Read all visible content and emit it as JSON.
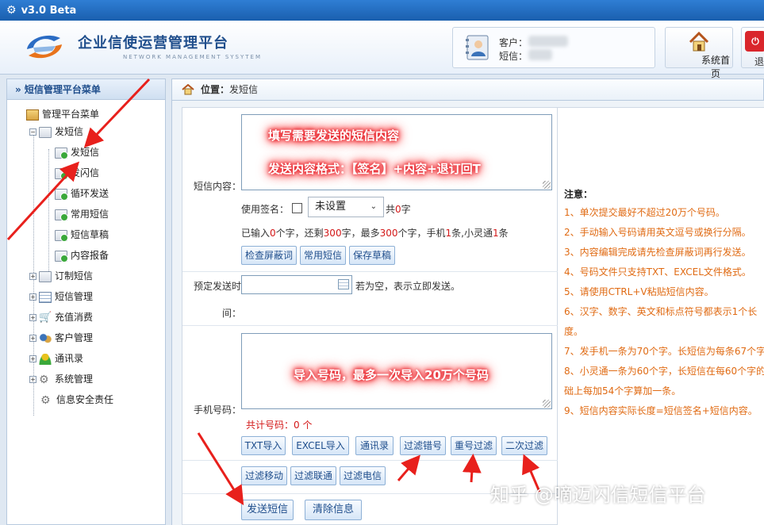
{
  "window": {
    "title": "v3.0 Beta"
  },
  "header": {
    "brand": "企业信使运营管理平台",
    "brand_sub": "NETWORK  MANAGEMENT SYSYTEM",
    "customer_label": "客户：",
    "sms_label": "短信：",
    "home_label": "系统首页",
    "exit_label": "退"
  },
  "sidebar": {
    "title": "» 短信管理平台菜单",
    "root": "管理平台菜单",
    "items": [
      {
        "label": "发短信"
      },
      {
        "label": "发短信"
      },
      {
        "label": "发闪信"
      },
      {
        "label": "循环发送"
      },
      {
        "label": "常用短信"
      },
      {
        "label": "短信草稿"
      },
      {
        "label": "内容报备"
      },
      {
        "label": "订制短信"
      },
      {
        "label": "短信管理"
      },
      {
        "label": "充值消费"
      },
      {
        "label": "客户管理"
      },
      {
        "label": "通讯录"
      },
      {
        "label": "系统管理"
      },
      {
        "label": "信息安全责任"
      }
    ]
  },
  "breadcrumb": {
    "prefix": "位置：",
    "current": "发短信"
  },
  "form": {
    "content_label": "短信内容：",
    "annotation_1": "填写需要发送的短信内容",
    "annotation_2": "发送内容格式：【签名】+内容+退订回T",
    "signature_label": "使用签名：",
    "signature_value": "未设置",
    "signature_count_prefix": "共",
    "signature_count": "0",
    "signature_count_suffix": "字",
    "count_text": {
      "p1": "已输入",
      "input_count": "0",
      "p2": "个字，还剩",
      "remaining": "300",
      "p3": "字，最多",
      "max": "300",
      "p4": "个字，手机",
      "mobile": "1",
      "p5": "条,小灵通",
      "phs": "1",
      "p6": "条"
    },
    "btn_check": "检查屏蔽词",
    "btn_common": "常用短信",
    "btn_draft": "保存草稿",
    "schedule_label_1": "预定发送时",
    "schedule_label_2": "间：",
    "schedule_hint": "若为空，表示立即发送。",
    "phone_label": "手机号码：",
    "annotation_3": "导入号码，最多一次导入20万个号码",
    "total_label": "共计号码：0 个",
    "btn_txt": "TXT导入",
    "btn_excel": "EXCEL导入",
    "btn_contacts": "通讯录",
    "btn_filter_err": "过滤错号",
    "btn_filter_dup": "重号过滤",
    "btn_filter_second": "二次过滤",
    "btn_filter_mobile": "过滤移动",
    "btn_filter_unicom": "过滤联通",
    "btn_filter_telecom": "过滤电信",
    "btn_send": "发送短信",
    "btn_clear": "清除信息"
  },
  "notes": {
    "title": "注意：",
    "items": [
      "1、单次提交最好不超过20万个号码。",
      "2、手动输入号码请用英文逗号或换行分隔。",
      "3、内容编辑完成请先检查屏蔽词再行发送。",
      "4、号码文件只支持TXT、EXCEL文件格式。",
      "5、请使用CTRL+V粘贴短信内容。",
      "6、汉字、数字、英文和标点符号都表示1个长",
      "度。",
      "7、发手机一条为70个字。长短信为每条67个字。",
      "8、小灵通一条为60个字，长短信在每60个字的基",
      "础上每加54个字算加一条。",
      "9、短信内容实际长度=短信签名+短信内容。"
    ]
  },
  "watermark": "知乎 @嘀迈闪信短信平台",
  "colors": {
    "accent": "#1f4e8c",
    "note": "#e06b14",
    "annotation_glow": "#e0101a",
    "arrow": "#e8201c"
  }
}
